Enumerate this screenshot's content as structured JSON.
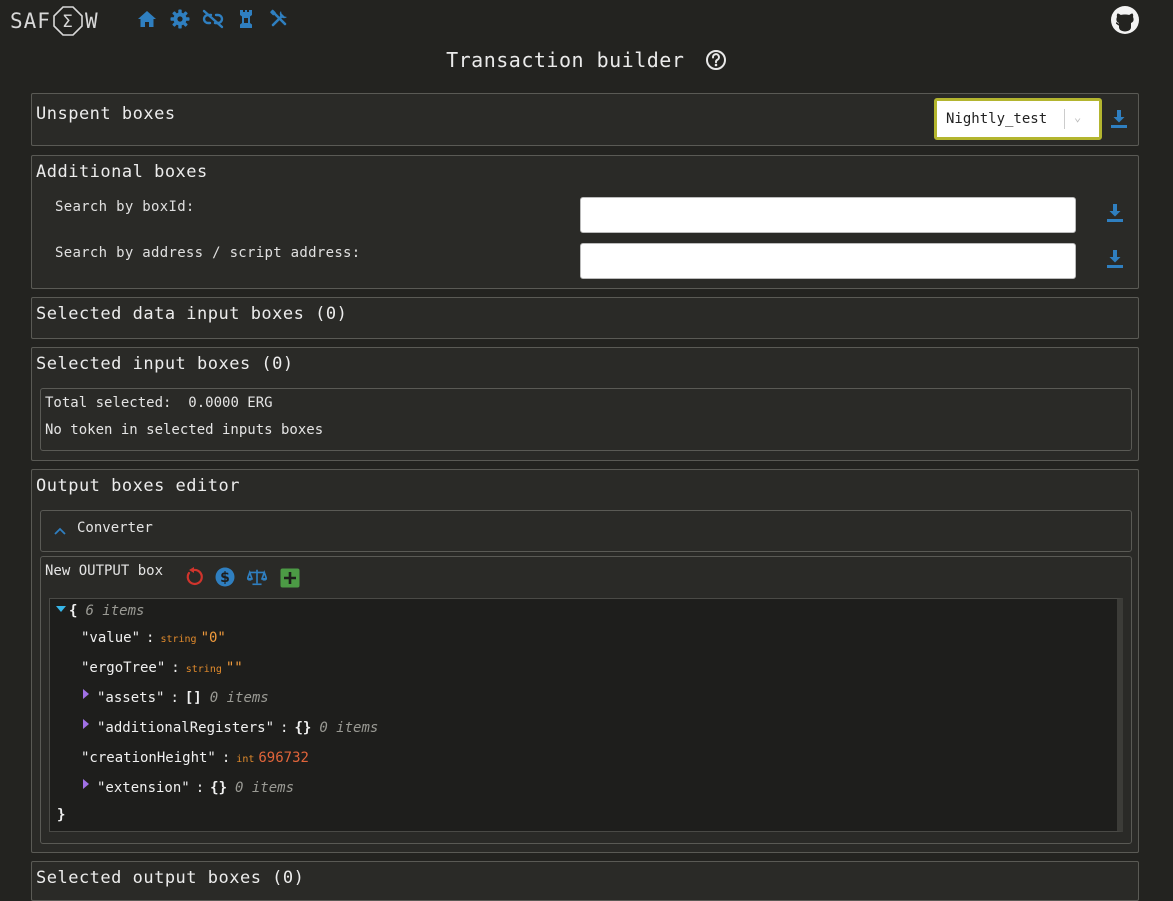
{
  "app": {
    "logo_left": "SAF",
    "logo_sigma": "Σ",
    "logo_right": "W",
    "nav_icons": [
      "home-icon",
      "gear-icon",
      "broken-link-icon",
      "chess-rook-icon",
      "tools-icon"
    ],
    "github_icon": "github-icon",
    "accent_color": "#2f7fc0"
  },
  "page": {
    "title": "Transaction builder",
    "help_icon": "question-circle-icon"
  },
  "unspent": {
    "title": "Unspent boxes",
    "wallet_selected": "Nightly_test",
    "select_highlight_color": "#b3b52f"
  },
  "additional": {
    "title": "Additional boxes",
    "search_boxid_label": "Search by boxId:",
    "search_boxid_value": "",
    "search_address_label": "Search by address / script address:",
    "search_address_value": ""
  },
  "data_inputs": {
    "title": "Selected data input boxes (0)"
  },
  "inputs": {
    "title": "Selected input boxes (0)",
    "total_label": "Total selected:",
    "total_value": "0.0000 ERG",
    "tokens_text": "No token in selected inputs boxes"
  },
  "output_editor": {
    "title": "Output boxes editor",
    "converter_label": "Converter",
    "new_output_label": "New OUTPUT box",
    "tool_icons": [
      "reset-icon",
      "dollar-icon",
      "balance-scale-icon",
      "plus-square-icon"
    ],
    "json": {
      "open_brace": "{",
      "close_brace": "}",
      "root_count": "6 items",
      "rows": [
        {
          "key": "\"value\"",
          "type": "string",
          "value": "\"0\""
        },
        {
          "key": "\"ergoTree\"",
          "type": "string",
          "value": "\"\""
        },
        {
          "key": "\"assets\"",
          "brackets": "[]",
          "count": "0 items"
        },
        {
          "key": "\"additionalRegisters\"",
          "brackets": "{}",
          "count": "0 items"
        },
        {
          "key": "\"creationHeight\"",
          "type": "int",
          "value": "696732"
        },
        {
          "key": "\"extension\"",
          "brackets": "{}",
          "count": "0 items"
        }
      ]
    }
  },
  "outputs": {
    "title": "Selected output boxes (0)"
  }
}
